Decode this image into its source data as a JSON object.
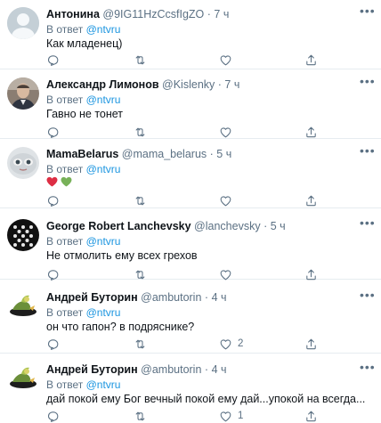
{
  "reply_prefix": "В ответ",
  "menu_glyph": "•••",
  "tweets": [
    {
      "name": "Антонина",
      "handle": "@9IG11HzCcsfIgZO",
      "dot": "·",
      "time": "7 ч",
      "reply_to": "@ntvru",
      "text": "Как младенец)",
      "reply_count": "",
      "retweet_count": "",
      "like_count": ""
    },
    {
      "name": "Александр Лимонов",
      "handle": "@Kislenky",
      "dot": "·",
      "time": "7 ч",
      "reply_to": "@ntvru",
      "text": "Гавно не тонет",
      "reply_count": "",
      "retweet_count": "",
      "like_count": ""
    },
    {
      "name": "MamaBelarus",
      "handle": "@mama_belarus",
      "dot": "·",
      "time": "5 ч",
      "reply_to": "@ntvru",
      "text": "",
      "emoji": [
        "red-heart",
        "green-heart"
      ],
      "reply_count": "",
      "retweet_count": "",
      "like_count": ""
    },
    {
      "name": "George Robert Lanchevsky",
      "handle": "@lanchevsky",
      "dot": "·",
      "time": "5 ч",
      "reply_to": "@ntvru",
      "text": "Не отмолить ему всех грехов",
      "reply_count": "",
      "retweet_count": "",
      "like_count": ""
    },
    {
      "name": "Андрей Буторин",
      "handle": "@ambutorin",
      "dot": "·",
      "time": "4 ч",
      "reply_to": "@ntvru",
      "text": "он что гапон? в подряснике?",
      "reply_count": "",
      "retweet_count": "",
      "like_count": "2"
    },
    {
      "name": "Андрей Буторин",
      "handle": "@ambutorin",
      "dot": "·",
      "time": "4 ч",
      "reply_to": "@ntvru",
      "text": "дай покой ему Бог вечный покой ему дай...упокой на всегда...",
      "reply_count": "",
      "retweet_count": "",
      "like_count": "1"
    }
  ],
  "colors": {
    "accent": "#1b95e0",
    "secondary_text": "#5b7083",
    "divider": "#e6ecf0"
  }
}
